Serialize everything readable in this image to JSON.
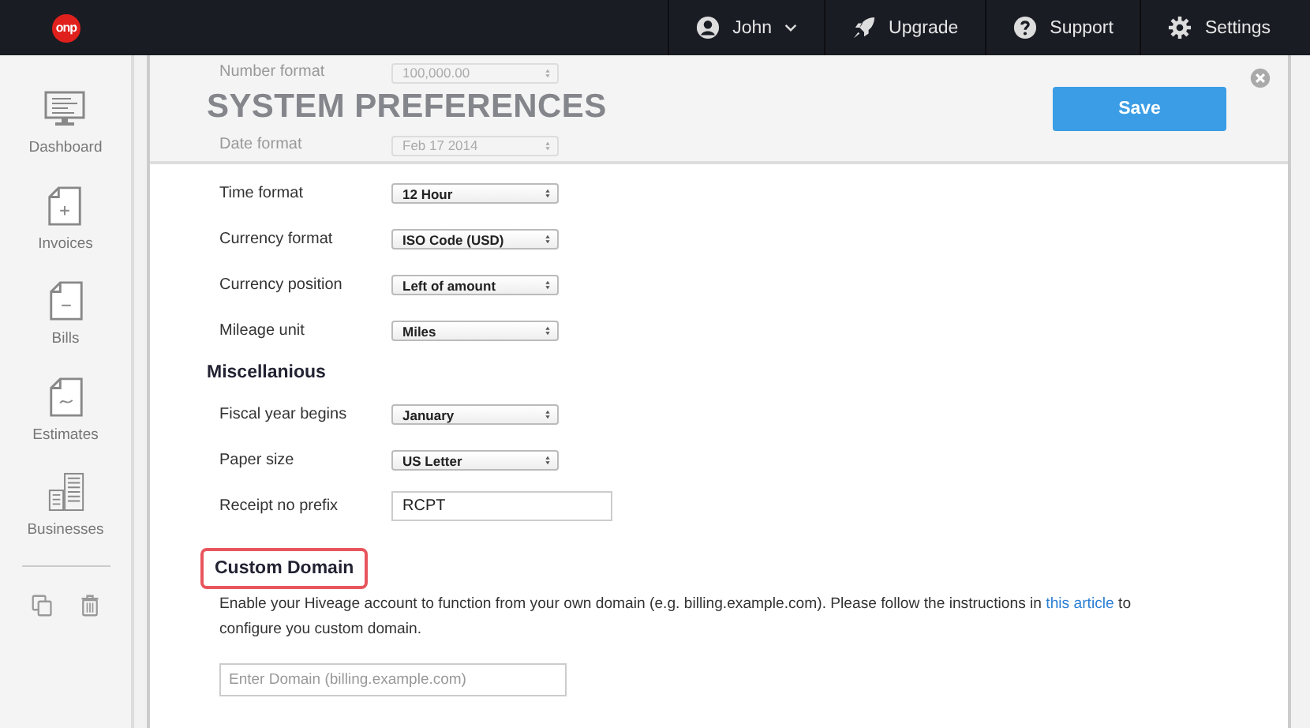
{
  "topbar": {
    "logo_text": "onp",
    "items": [
      {
        "kind": "user",
        "label": "John"
      },
      {
        "kind": "upgrade",
        "label": "Upgrade"
      },
      {
        "kind": "support",
        "label": "Support"
      },
      {
        "kind": "settings",
        "label": "Settings"
      }
    ]
  },
  "sidebar": {
    "items": [
      {
        "kind": "dashboard",
        "label": "Dashboard"
      },
      {
        "kind": "invoices",
        "label": "Invoices"
      },
      {
        "kind": "bills",
        "label": "Bills"
      },
      {
        "kind": "estimates",
        "label": "Estimates"
      },
      {
        "kind": "businesses",
        "label": "Businesses"
      }
    ]
  },
  "header": {
    "title": "SYSTEM PREFERENCES",
    "save_button": "Save"
  },
  "behind_header_rows": [
    {
      "label": "Number format",
      "value": "100,000.00"
    },
    {
      "label": "Date format",
      "value": "Feb 17 2014"
    }
  ],
  "rows": [
    {
      "kind": "select",
      "label": "Time format",
      "value": "12 Hour"
    },
    {
      "kind": "select",
      "label": "Currency format",
      "value": "ISO Code (USD)"
    },
    {
      "kind": "select",
      "label": "Currency position",
      "value": "Left of amount"
    },
    {
      "kind": "select",
      "label": "Mileage unit",
      "value": "Miles"
    },
    {
      "kind": "heading",
      "label": "Miscellanious"
    },
    {
      "kind": "select",
      "label": "Fiscal year begins",
      "value": "January"
    },
    {
      "kind": "select",
      "label": "Paper size",
      "value": "US Letter"
    },
    {
      "kind": "input",
      "label": "Receipt no prefix",
      "value": "RCPT"
    }
  ],
  "custom_domain": {
    "heading": "Custom Domain",
    "highlighted": true,
    "text_before": "Enable your Hiveage account to function from your own domain (e.g. billing.example.com). Please follow the instructions in",
    "link": "this article",
    "text_after": "to configure you custom domain.",
    "placeholder": "Enter Domain (billing.example.com)"
  }
}
